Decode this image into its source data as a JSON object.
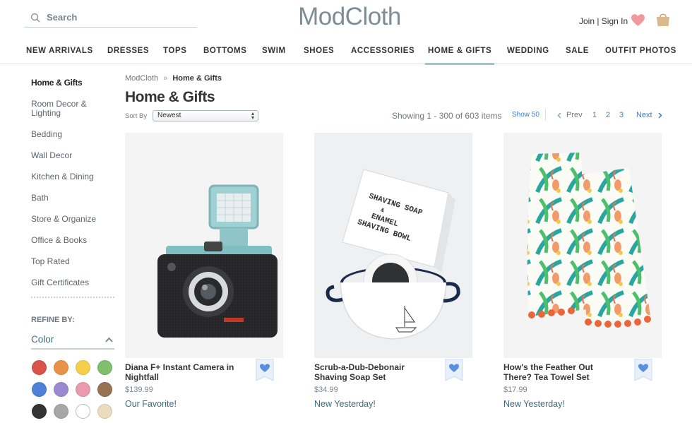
{
  "header": {
    "search_placeholder": "Search",
    "logo": "ModCloth",
    "account": "Join | Sign In"
  },
  "nav": [
    "NEW ARRIVALS",
    "DRESSES",
    "TOPS",
    "BOTTOMS",
    "SWIM",
    "SHOES",
    "ACCESSORIES",
    "HOME & GIFTS",
    "WEDDING",
    "SALE",
    "OUTFIT PHOTOS"
  ],
  "sidebar": {
    "current": "Home & Gifts",
    "items": [
      "Room Decor & Lighting",
      "Bedding",
      "Wall Decor",
      "Kitchen & Dining",
      "Bath",
      "Store & Organize",
      "Office & Books",
      "Top Rated",
      "Gift Certificates"
    ],
    "refine_label": "REFINE BY:",
    "color_label": "Color",
    "swatch_colors": [
      "#d9534b",
      "#ea9149",
      "#f5cf4a",
      "#7fbf6d",
      "#4e82d6",
      "#9b89cf",
      "#e99aae",
      "#977354",
      "#333333",
      "#a7a7a7",
      "#ffffff",
      "#e9dcc0"
    ]
  },
  "breadcrumb": {
    "root": "ModCloth",
    "separator": "»",
    "current": "Home & Gifts"
  },
  "page_title": "Home & Gifts",
  "sort": {
    "label": "Sort By",
    "value": "Newest"
  },
  "results": {
    "showing": "Showing 1 - 300 of 603 items",
    "show50": "Show 50",
    "prev": "Prev",
    "pages": [
      "1",
      "2",
      "3"
    ],
    "next": "Next"
  },
  "products": [
    {
      "name": "Diana F+ Instant Camera in Nightfall",
      "price": "$139.99",
      "tag": "Our Favorite!"
    },
    {
      "name": "Scrub-a-Dub-Debonair Shaving Soap Set",
      "price": "$34.99",
      "tag": "New Yesterday!"
    },
    {
      "name": "How's the Feather Out There? Tea Towel Set",
      "price": "$17.99",
      "tag": "New Yesterday!"
    }
  ],
  "colors": {
    "accent_blue": "#3d7cc9",
    "nav_underline": "#9ac4d4",
    "heart": "#f09aa0",
    "fav_blue": "#5a8fe0"
  }
}
